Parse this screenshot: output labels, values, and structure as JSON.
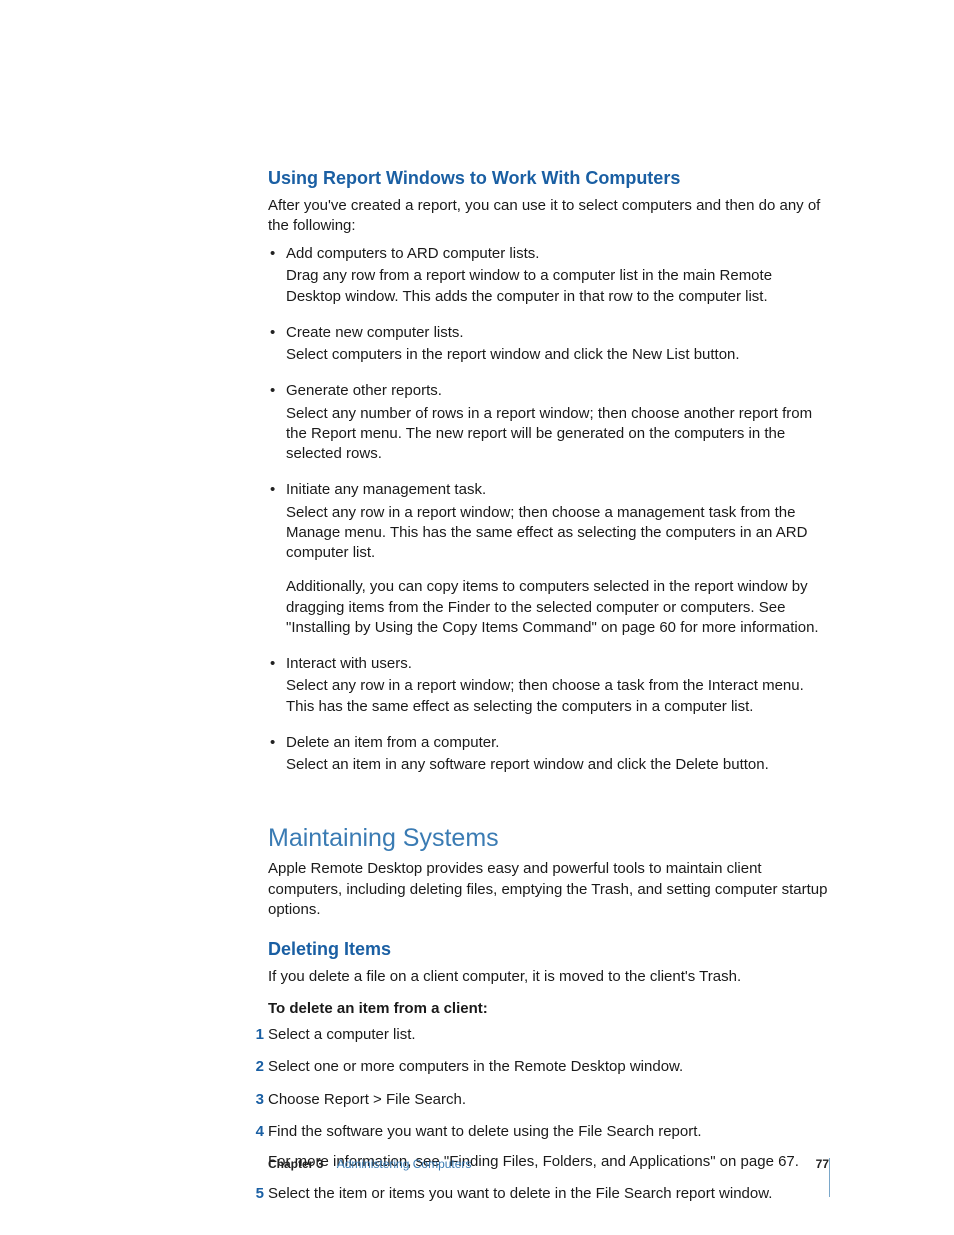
{
  "section1": {
    "heading": "Using Report Windows to Work With Computers",
    "intro": "After you've created a report, you can use it to select computers and then do any of the following:",
    "bullets": [
      {
        "lead": "Add computers to ARD computer lists.",
        "cont": "Drag any row from a report window to a computer list in the main Remote Desktop window. This adds the computer in that row to the computer list."
      },
      {
        "lead": "Create new computer lists.",
        "cont": "Select computers in the report window and click the New List button."
      },
      {
        "lead": "Generate other reports.",
        "cont": "Select any number of rows in a report window; then choose another report from the Report menu. The new report will be generated on the computers in the selected rows."
      },
      {
        "lead": "Initiate any management task.",
        "cont": "Select any row in a report window; then choose a management task from the Manage menu. This has the same effect as selecting the computers in an ARD computer list.",
        "para2": "Additionally, you can copy items to computers selected in the report window by dragging items from the Finder to the selected computer or computers. See \"Installing by Using the Copy Items Command\" on page 60 for more information."
      },
      {
        "lead": "Interact with users.",
        "cont": "Select any row in a report window; then choose a task from the Interact menu. This has the same effect as selecting the computers in a computer list."
      },
      {
        "lead": "Delete an item from a computer.",
        "cont": "Select an item in any software report window and click the Delete button."
      }
    ]
  },
  "section2": {
    "heading": "Maintaining Systems",
    "intro": "Apple Remote Desktop provides easy and powerful tools to maintain client computers, including deleting files, emptying the Trash, and setting computer startup options."
  },
  "section3": {
    "heading": "Deleting Items",
    "intro": "If you delete a file on a client computer, it is moved to the client's Trash.",
    "instr": "To delete an item from a client:",
    "steps": [
      {
        "n": "1",
        "t": "Select a computer list."
      },
      {
        "n": "2",
        "t": "Select one or more computers in the Remote Desktop window."
      },
      {
        "n": "3",
        "t": "Choose Report > File Search."
      },
      {
        "n": "4",
        "t": "Find the software you want to delete using the File Search report.",
        "extra": "For more information, see \"Finding Files, Folders, and Applications\" on page 67."
      },
      {
        "n": "5",
        "t": "Select the item or items you want to delete in the File Search report window."
      }
    ]
  },
  "footer": {
    "chapter": "Chapter 3",
    "title": "Administering Computers",
    "page": "77"
  }
}
